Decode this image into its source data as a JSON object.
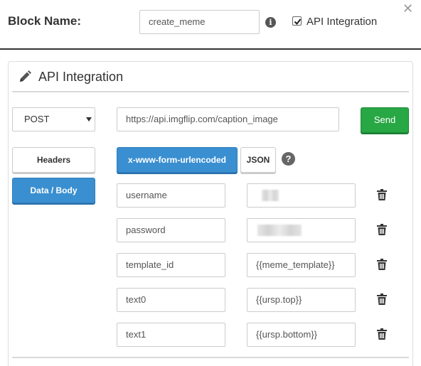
{
  "header": {
    "block_name_label": "Block Name:",
    "block_name_value": "create_meme",
    "api_integration_label": "API Integration",
    "api_integration_checked": true
  },
  "panel": {
    "title": "API Integration"
  },
  "request": {
    "method": "POST",
    "url": "https://api.imgflip.com/caption_image",
    "send_label": "Send"
  },
  "nav": {
    "headers_label": "Headers",
    "data_label": "Data / Body",
    "active": "Data / Body"
  },
  "body_type": {
    "form_label": "x-www-form-urlencoded",
    "json_label": "JSON",
    "active": "x-www-form-urlencoded"
  },
  "params": [
    {
      "key": "username",
      "value": ""
    },
    {
      "key": "password",
      "value": ""
    },
    {
      "key": "template_id",
      "value": "{{meme_template}}"
    },
    {
      "key": "text0",
      "value": "{{ursp.top}}"
    },
    {
      "key": "text1",
      "value": "{{ursp.bottom}}"
    }
  ],
  "colors": {
    "send": "#28a745",
    "active_blue": "#3a8fd0",
    "divider": "#333333"
  },
  "icons": {
    "info": "info-icon",
    "close": "close-icon",
    "pencil": "pencil-icon",
    "help": "help-icon",
    "trash": "trash-icon"
  }
}
